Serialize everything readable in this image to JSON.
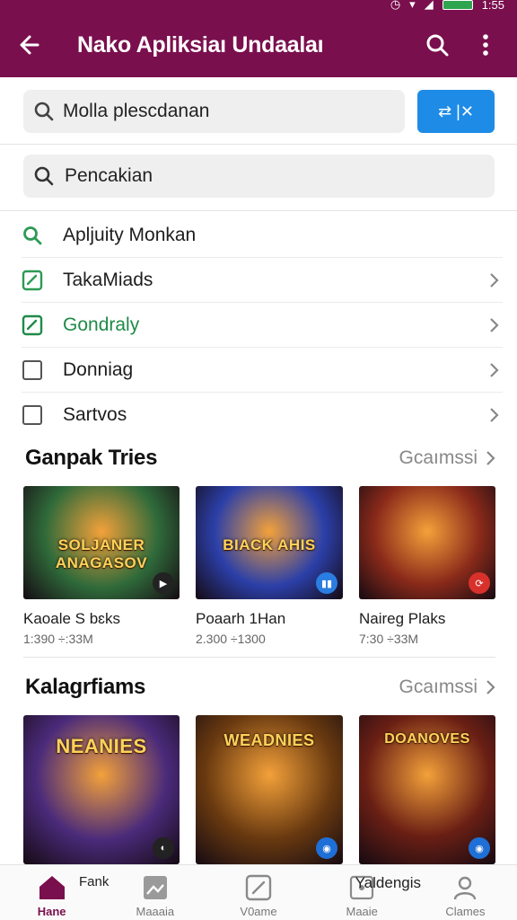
{
  "status": {
    "time": "1:55"
  },
  "appbar": {
    "title": "Nako Apliksiaı Undaalaı"
  },
  "search": {
    "query": "Molla plescdanan",
    "filter_label": "⇄ |✕"
  },
  "search2": {
    "query": "Pencakian"
  },
  "menu": [
    {
      "label": "Apljuity Monkan",
      "green": false,
      "icon": "search-icon",
      "chevron": false
    },
    {
      "label": "TakaMiads",
      "green": false,
      "icon": "edit-box-icon",
      "chevron": true
    },
    {
      "label": "Gondraly",
      "green": true,
      "icon": "checkbox-edit-icon",
      "chevron": true
    },
    {
      "label": "Donniag",
      "green": false,
      "icon": "checkbox-icon",
      "chevron": true
    },
    {
      "label": "Sartvos",
      "green": false,
      "icon": "checkbox-icon",
      "chevron": true
    }
  ],
  "section1": {
    "title": "Ganpak Tries",
    "more": "Gcaımssi",
    "cards": [
      {
        "title": "Kaoale S bɛks",
        "meta": "1:390 ÷:33M",
        "art": "SOLJANER ANAGASOV",
        "bg": "#2f6a3a",
        "badge_color": "#222222"
      },
      {
        "title": "Poaarh 1Han",
        "meta": "2.300 ÷1300",
        "art": "BIACK AHIS",
        "bg": "#2b3fa8",
        "badge_color": "#2a7de1"
      },
      {
        "title": "Naireg Plaks",
        "meta": "7:30 ÷33M",
        "art": "",
        "bg": "#8a2a1a",
        "badge_color": "#d8312c"
      }
    ]
  },
  "section2": {
    "title": "Kalagrfiams",
    "more": "Gcaımssi",
    "cards": [
      {
        "art": "NEANIES",
        "bg": "#4a2a7a",
        "badge_color": "#222222"
      },
      {
        "art": "WEADNIES",
        "bg": "#6a3a10",
        "badge_color": "#1e6fd6"
      },
      {
        "art": "DOANOVES",
        "bg": "#6a1f14",
        "badge_color": "#1e6fd6"
      }
    ]
  },
  "bottom_nav": [
    {
      "label": "Hane",
      "icon": "home-icon",
      "active": true,
      "float": "Fank"
    },
    {
      "label": "Maaaia",
      "icon": "image-icon",
      "active": false
    },
    {
      "label": "V0ame",
      "icon": "edit-icon",
      "active": false
    },
    {
      "label": "Maaie",
      "icon": "media-icon",
      "active": false,
      "float": "Yaldengis"
    },
    {
      "label": "Clames",
      "icon": "person-icon",
      "active": false
    }
  ]
}
